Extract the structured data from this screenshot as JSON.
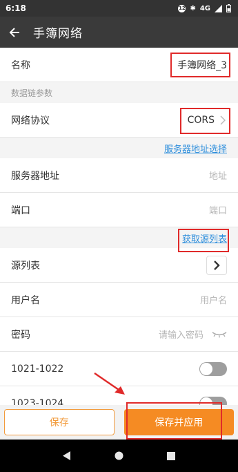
{
  "status_bar": {
    "time": "6:18",
    "badge": "12",
    "network": "4G"
  },
  "app_bar": {
    "title": "手簿网络"
  },
  "form": {
    "name_label": "名称",
    "name_value": "手簿网络_3",
    "section_label": "数据链参数",
    "protocol_label": "网络协议",
    "protocol_value": "CORS",
    "server_select_link": "服务器地址选择",
    "server_label": "服务器地址",
    "server_placeholder": "地址",
    "port_label": "端口",
    "port_placeholder": "端口",
    "source_list_link": "获取源列表",
    "source_list_label": "源列表",
    "username_label": "用户名",
    "username_placeholder": "用户名",
    "password_label": "密码",
    "password_placeholder": "请输入密码",
    "toggle1_label": "1021-1022",
    "toggle2_label": "1023-1024"
  },
  "buttons": {
    "save": "保存",
    "save_apply": "保存并应用"
  },
  "colors": {
    "accent": "#f58b23",
    "link": "#2f8fdc",
    "annotation": "#e02a2a"
  }
}
